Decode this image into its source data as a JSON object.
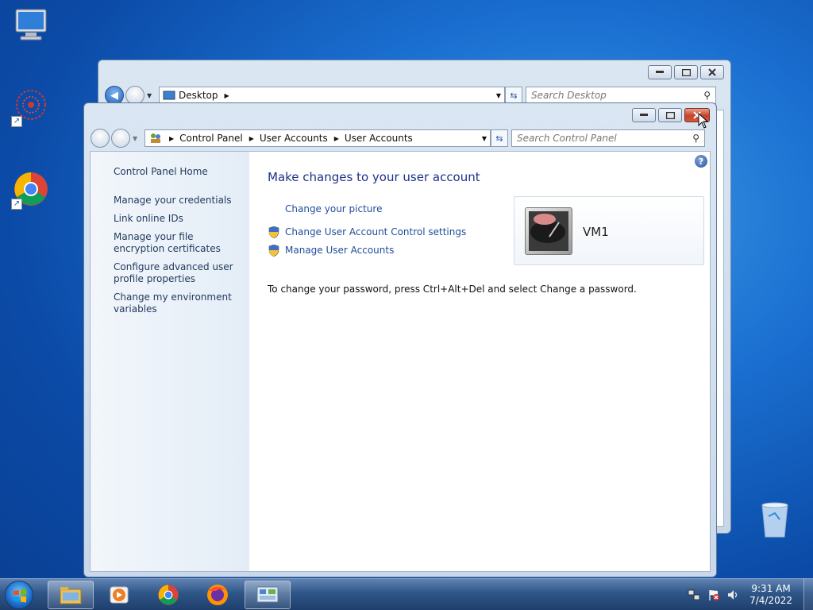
{
  "back_window": {
    "address_item": "Desktop",
    "search_placeholder": "Search Desktop"
  },
  "front_window": {
    "breadcrumb": [
      "Control Panel",
      "User Accounts",
      "User Accounts"
    ],
    "search_placeholder": "Search Control Panel",
    "left_pane": {
      "home": "Control Panel Home",
      "links": [
        "Manage your credentials",
        "Link online IDs",
        "Manage your file encryption certificates",
        "Configure advanced user profile properties",
        "Change my environment variables"
      ]
    },
    "main": {
      "title": "Make changes to your user account",
      "task_links": [
        "Change your picture",
        "Change User Account Control settings",
        "Manage User Accounts"
      ],
      "user_name": "VM1",
      "password_note": "To change your password, press Ctrl+Alt+Del and select Change a password."
    }
  },
  "taskbar": {
    "time": "9:31 AM",
    "date": "7/4/2022"
  },
  "colors": {
    "link": "#1e4e9a",
    "heading": "#1e3287",
    "desktop": "#1a6fd0"
  }
}
